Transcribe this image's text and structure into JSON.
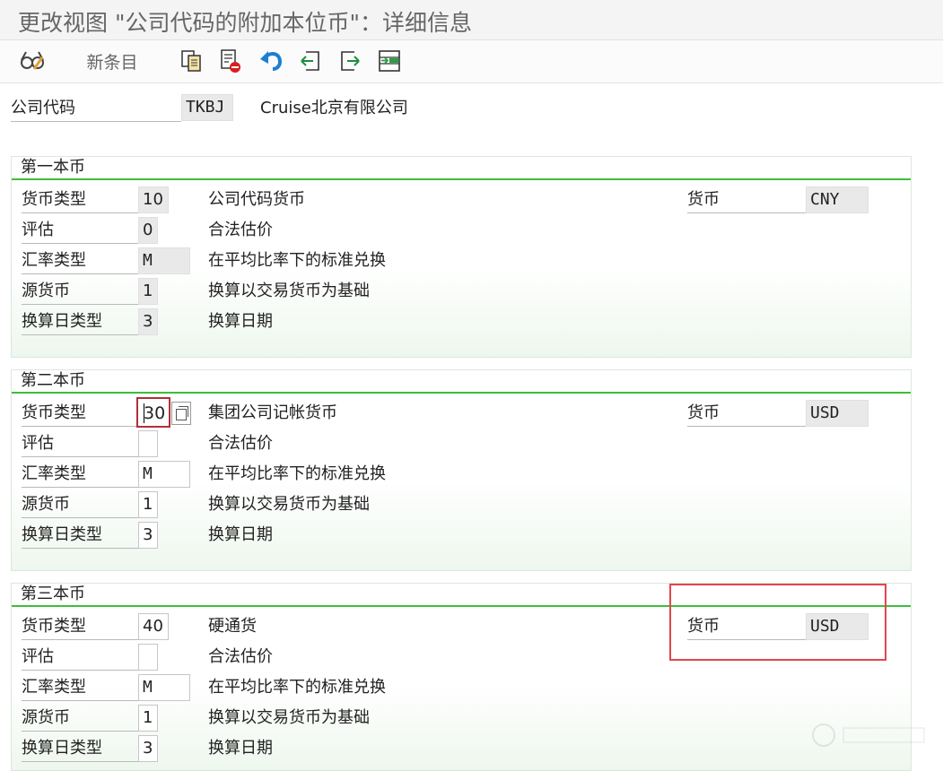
{
  "window": {
    "title": "更改视图 \"公司代码的附加本位币\"：详细信息"
  },
  "toolbar": {
    "glasses_icon": "glasses-icon",
    "new_entries_label": "新条目",
    "copy_icon": "copy-icon",
    "delete_icon": "delete-icon",
    "undo_icon": "undo-icon",
    "prev_icon": "previous-entry-icon",
    "next_icon": "next-entry-icon",
    "select_icon": "select-block-icon"
  },
  "header": {
    "company_code_label": "公司代码",
    "company_code_value": "TKBJ",
    "company_name": "Cruise北京有限公司"
  },
  "groups": [
    {
      "title": "第一本币",
      "currency_type_label": "货币类型",
      "currency_type_value": "10",
      "currency_type_desc": "公司代码货币",
      "valuation_label": "评估",
      "valuation_value": "0",
      "valuation_desc": "合法估价",
      "rate_type_label": "汇率类型",
      "rate_type_value": "M",
      "rate_type_desc": "在平均比率下的标准兑换",
      "source_currency_label": "源货币",
      "source_currency_value": "1",
      "source_currency_desc": "换算以交易货币为基础",
      "date_type_label": "换算日类型",
      "date_type_value": "3",
      "date_type_desc": "换算日期",
      "currency_label": "货币",
      "currency_value": "CNY"
    },
    {
      "title": "第二本币",
      "currency_type_label": "货币类型",
      "currency_type_value": "30",
      "currency_type_desc": "集团公司记帐货币",
      "valuation_label": "评估",
      "valuation_value": "",
      "valuation_desc": "合法估价",
      "rate_type_label": "汇率类型",
      "rate_type_value": "M",
      "rate_type_desc": "在平均比率下的标准兑换",
      "source_currency_label": "源货币",
      "source_currency_value": "1",
      "source_currency_desc": "换算以交易货币为基础",
      "date_type_label": "换算日类型",
      "date_type_value": "3",
      "date_type_desc": "换算日期",
      "currency_label": "货币",
      "currency_value": "USD"
    },
    {
      "title": "第三本币",
      "currency_type_label": "货币类型",
      "currency_type_value": "40",
      "currency_type_desc": "硬通货",
      "valuation_label": "评估",
      "valuation_value": "",
      "valuation_desc": "合法估价",
      "rate_type_label": "汇率类型",
      "rate_type_value": "M",
      "rate_type_desc": "在平均比率下的标准兑换",
      "source_currency_label": "源货币",
      "source_currency_value": "1",
      "source_currency_desc": "换算以交易货币为基础",
      "date_type_label": "换算日类型",
      "date_type_value": "3",
      "date_type_desc": "换算日期",
      "currency_label": "货币",
      "currency_value": "USD"
    }
  ],
  "colors": {
    "accent_green": "#3bbf3b",
    "highlight_red": "#e0474c"
  }
}
